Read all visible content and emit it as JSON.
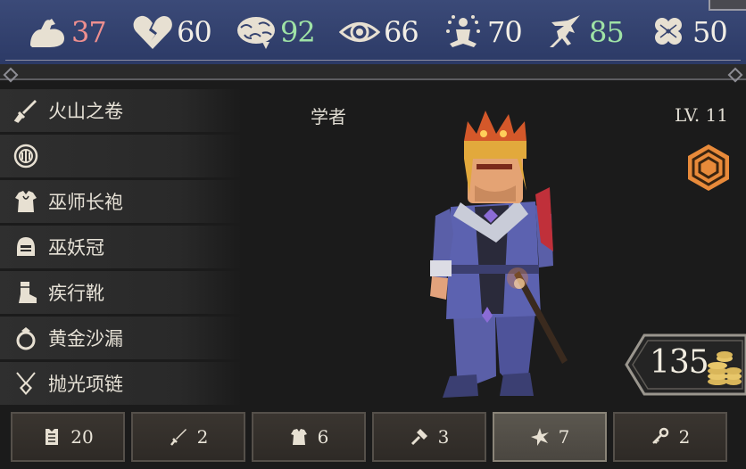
{
  "stats": [
    {
      "icon": "strength-arm-icon",
      "value": "37",
      "color": "#ef8f8f"
    },
    {
      "icon": "broken-heart-icon",
      "value": "60",
      "color": "#f2eee6"
    },
    {
      "icon": "brain-icon",
      "value": "92",
      "color": "#9fe3a6"
    },
    {
      "icon": "eye-icon",
      "value": "66",
      "color": "#f2eee6"
    },
    {
      "icon": "meditation-icon",
      "value": "70",
      "color": "#f2eee6"
    },
    {
      "icon": "agility-icon",
      "value": "85",
      "color": "#9fe3a6"
    },
    {
      "icon": "clover-icon",
      "value": "50",
      "color": "#f2eee6"
    }
  ],
  "equipment": [
    {
      "icon": "sword-icon",
      "label": "火山之卷"
    },
    {
      "icon": "shield-icon",
      "label": ""
    },
    {
      "icon": "robe-icon",
      "label": "巫师长袍"
    },
    {
      "icon": "helmet-icon",
      "label": "巫妖冠"
    },
    {
      "icon": "boot-icon",
      "label": "疾行靴"
    },
    {
      "icon": "ring-icon",
      "label": "黄金沙漏"
    },
    {
      "icon": "necklace-icon",
      "label": "抛光项链"
    }
  ],
  "character": {
    "class_name": "学者",
    "level": "LV. 11"
  },
  "gold": {
    "amount": "135"
  },
  "tabs": [
    {
      "icon": "armor-icon",
      "count": "20",
      "active": false
    },
    {
      "icon": "sword-icon",
      "count": "2",
      "active": false
    },
    {
      "icon": "robe-icon",
      "count": "6",
      "active": false
    },
    {
      "icon": "hammer-icon",
      "count": "3",
      "active": false
    },
    {
      "icon": "star-shard-icon",
      "count": "7",
      "active": true
    },
    {
      "icon": "key-icon",
      "count": "2",
      "active": false
    }
  ],
  "colors": {
    "accent": "#e88a3a",
    "statbar": "#34426f"
  }
}
